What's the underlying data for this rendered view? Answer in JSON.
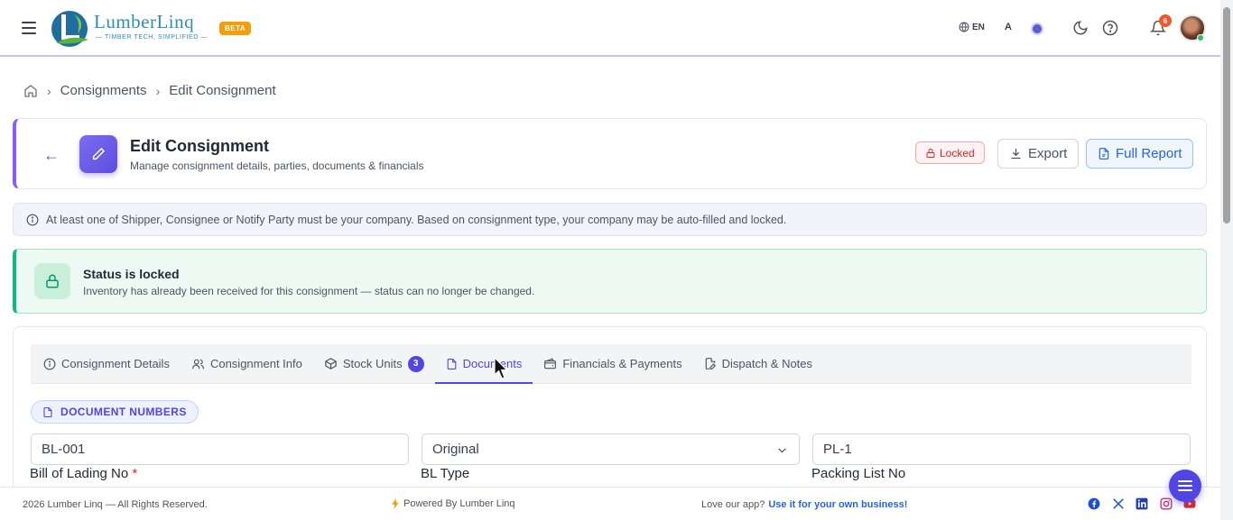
{
  "header": {
    "logo_text": "LumberLinq",
    "logo_tagline": "— TIMBER TECH, SIMPLIFIED —",
    "beta_label": "BETA",
    "language_code": "EN",
    "font_size_label": "A",
    "notification_count": "6",
    "accent_color": "#5b5bd6"
  },
  "breadcrumb": {
    "home_icon": "home-icon",
    "items": [
      "Consignments",
      "Edit Consignment"
    ]
  },
  "page_header": {
    "title": "Edit Consignment",
    "subtitle": "Manage consignment details, parties, documents & financials",
    "locked_label": "Locked",
    "export_label": "Export",
    "full_report_label": "Full Report"
  },
  "info_bar": {
    "text": "At least one of Shipper, Consignee or Notify Party must be your company. Based on consignment type, your company may be auto-filled and locked."
  },
  "status": {
    "title": "Status is locked",
    "subtitle": "Inventory has already been received for this consignment — status can no longer be changed."
  },
  "tabs": [
    {
      "label": "Consignment Details",
      "icon": "info-icon"
    },
    {
      "label": "Consignment Info",
      "icon": "users-icon"
    },
    {
      "label": "Stock Units",
      "icon": "box-icon",
      "count": "3"
    },
    {
      "label": "Documents",
      "icon": "document-icon",
      "active": true
    },
    {
      "label": "Financials & Payments",
      "icon": "wallet-icon"
    },
    {
      "label": "Dispatch & Notes",
      "icon": "file-edit-icon"
    }
  ],
  "section": {
    "title": "DOCUMENT NUMBERS"
  },
  "fields": {
    "bill_of_lading": {
      "value": "BL-001",
      "label": "Bill of Lading No",
      "required_mark": "*"
    },
    "bl_type": {
      "value": "Original",
      "label": "BL Type"
    },
    "packing_list": {
      "value": "PL-1",
      "label": "Packing List No"
    }
  },
  "footer": {
    "copyright": "2026 Lumber Linq — All Rights Reserved.",
    "powered_by": "Powered By Lumber Linq",
    "love_text": "Love our app?",
    "love_link": "Use it for your own business!",
    "social_icons": [
      "facebook-icon",
      "x-icon",
      "linkedin-icon",
      "instagram-icon",
      "youtube-icon"
    ]
  }
}
